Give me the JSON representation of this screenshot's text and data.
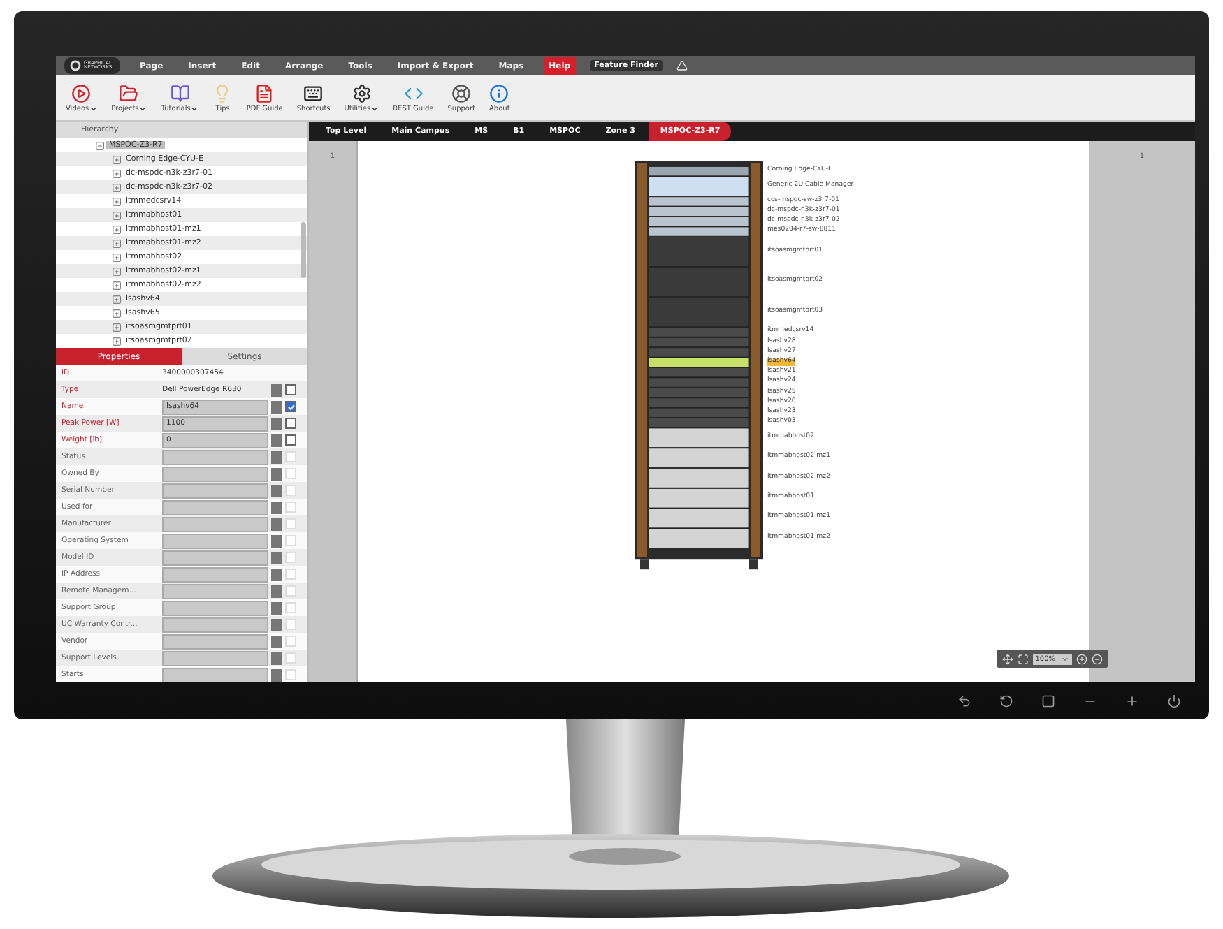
{
  "app": {
    "logo": "GRAPHICAL NETWORKS",
    "menu": [
      {
        "label": "Page",
        "selected": false
      },
      {
        "label": "Insert",
        "selected": false
      },
      {
        "label": "Edit",
        "selected": false
      },
      {
        "label": "Arrange",
        "selected": false
      },
      {
        "label": "Tools",
        "selected": false
      },
      {
        "label": "Import & Export",
        "selected": false
      },
      {
        "label": "Maps",
        "selected": false
      },
      {
        "label": "Help",
        "selected": true
      }
    ],
    "feature_finder": "Feature Finder",
    "toolbar": [
      {
        "kind": "video",
        "label": "Videos",
        "dropdown": true
      },
      {
        "kind": "projects",
        "label": "Projects",
        "dropdown": true
      },
      {
        "kind": "tutorials",
        "label": "Tutorials",
        "dropdown": true
      },
      {
        "kind": "tips",
        "label": "Tips",
        "dropdown": false
      },
      {
        "kind": "pdf",
        "label": "PDF Guide",
        "dropdown": false
      },
      {
        "kind": "shortcuts",
        "label": "Shortcuts",
        "dropdown": false
      },
      {
        "kind": "utilities",
        "label": "Utilities",
        "dropdown": true
      },
      {
        "kind": "rest",
        "label": "REST Guide",
        "dropdown": false
      },
      {
        "kind": "support",
        "label": "Support",
        "dropdown": false
      },
      {
        "kind": "about",
        "label": "About",
        "dropdown": false
      }
    ]
  },
  "hierarchy": {
    "title": "Hierarchy",
    "tree": [
      {
        "label": "MSPOC-Z3-R7",
        "expanded": true,
        "selected": true,
        "children": [
          {
            "label": "Corning Edge-CYU-E",
            "expanded": false,
            "selected": false
          },
          {
            "label": "dc-mspdc-n3k-z3r7-01",
            "expanded": false,
            "selected": false
          },
          {
            "label": "dc-mspdc-n3k-z3r7-02",
            "expanded": false,
            "selected": false
          },
          {
            "label": "itmmedcsrv14",
            "expanded": false,
            "selected": false
          },
          {
            "label": "itmmabhost01",
            "expanded": false,
            "selected": false
          },
          {
            "label": "itmmabhost01-mz1",
            "expanded": false,
            "selected": false
          },
          {
            "label": "itmmabhost01-mz2",
            "expanded": false,
            "selected": false
          },
          {
            "label": "itmmabhost02",
            "expanded": false,
            "selected": false
          },
          {
            "label": "itmmabhost02-mz1",
            "expanded": false,
            "selected": false
          },
          {
            "label": "itmmabhost02-mz2",
            "expanded": false,
            "selected": false
          },
          {
            "label": "lsashv64",
            "expanded": false,
            "selected": false
          },
          {
            "label": "lsashv65",
            "expanded": false,
            "selected": false
          },
          {
            "label": "itsoasmgmtprt01",
            "expanded": false,
            "selected": false
          },
          {
            "label": "itsoasmgmtprt02",
            "expanded": false,
            "selected": false
          }
        ]
      }
    ]
  },
  "panel_tabs": [
    {
      "label": "Properties",
      "selected": true
    },
    {
      "label": "Settings",
      "selected": false
    }
  ],
  "properties": [
    {
      "kind": "static",
      "label": "ID",
      "value": "3400000307454",
      "required": true
    },
    {
      "kind": "readonly",
      "label": "Type",
      "value": "Dell PowerEdge R630",
      "required": true,
      "checked": false
    },
    {
      "kind": "field",
      "label": "Name",
      "value": "lsashv64",
      "required": true,
      "checked": true
    },
    {
      "kind": "field",
      "label": "Peak Power [W]",
      "value": "1100",
      "required": true,
      "checked": false
    },
    {
      "kind": "field",
      "label": "Weight [lb]",
      "value": "0",
      "required": true,
      "checked": false
    },
    {
      "kind": "field",
      "label": "Status",
      "required": false,
      "checked": false
    },
    {
      "kind": "field",
      "label": "Owned By",
      "required": false,
      "checked": false
    },
    {
      "kind": "field",
      "label": "Serial Number",
      "required": false,
      "checked": false
    },
    {
      "kind": "field",
      "label": "Used for",
      "required": false,
      "checked": false
    },
    {
      "kind": "field",
      "label": "Manufacturer",
      "required": false,
      "checked": false
    },
    {
      "kind": "field",
      "label": "Operating System",
      "required": false,
      "checked": false
    },
    {
      "kind": "field",
      "label": "Model ID",
      "required": false,
      "checked": false
    },
    {
      "kind": "field",
      "label": "IP Address",
      "required": false,
      "checked": false
    },
    {
      "kind": "field",
      "label": "Remote Managem...",
      "required": false,
      "checked": false
    },
    {
      "kind": "field",
      "label": "Support Group",
      "required": false,
      "checked": false
    },
    {
      "kind": "field",
      "label": "UC Warranty Contr...",
      "required": false,
      "checked": false
    },
    {
      "kind": "field",
      "label": "Vendor",
      "required": false,
      "checked": false
    },
    {
      "kind": "field",
      "label": "Support Levels",
      "required": false,
      "checked": false
    },
    {
      "kind": "field",
      "label": "Starts",
      "required": false,
      "checked": false
    }
  ],
  "breadcrumb": [
    {
      "label": "Top Level",
      "selected": false
    },
    {
      "label": "Main Campus",
      "selected": false
    },
    {
      "label": "MS",
      "selected": false
    },
    {
      "label": "B1",
      "selected": false
    },
    {
      "label": "MSPOC",
      "selected": false
    },
    {
      "label": "Zone 3",
      "selected": false
    },
    {
      "label": "MSPOC-Z3-R7",
      "selected": true
    }
  ],
  "ruler_labels": [
    "1",
    "1"
  ],
  "rack": {
    "devices": [
      {
        "kind": "patch",
        "label": "Corning Edge-CYU-E",
        "selected": false
      },
      {
        "kind": "cable",
        "label": "Generic 2U Cable Manager",
        "selected": false
      },
      {
        "kind": "switch",
        "label": "ccs-mspdc-sw-z3r7-01",
        "selected": false
      },
      {
        "kind": "switch",
        "label": "dc-mspdc-n3k-z3r7-01",
        "selected": false
      },
      {
        "kind": "switch",
        "label": "dc-mspdc-n3k-z3r7-02",
        "selected": false
      },
      {
        "kind": "switch",
        "label": "mes0204-r7-sw-8811",
        "selected": false
      },
      {
        "kind": "server2",
        "label": "itsoasmgmtprt01",
        "selected": false
      },
      {
        "kind": "server2",
        "label": "itsoasmgmtprt02",
        "selected": false
      },
      {
        "kind": "server2",
        "label": "itsoasmgmtprt03",
        "selected": false
      },
      {
        "kind": "server1",
        "label": "itmmedcsrv14",
        "selected": false
      },
      {
        "kind": "server1",
        "label": "lsashv28",
        "selected": false
      },
      {
        "kind": "server1",
        "label": "lsashv27",
        "selected": false
      },
      {
        "kind": "server1",
        "label": "lsashv64",
        "selected": true
      },
      {
        "kind": "server1",
        "label": "lsashv21",
        "selected": false
      },
      {
        "kind": "server1",
        "label": "lsashv24",
        "selected": false
      },
      {
        "kind": "server1",
        "label": "lsashv25",
        "selected": false
      },
      {
        "kind": "server1",
        "label": "lsashv20",
        "selected": false
      },
      {
        "kind": "server1",
        "label": "lsashv23",
        "selected": false
      },
      {
        "kind": "server1",
        "label": "lsashv03",
        "selected": false
      },
      {
        "kind": "chassis",
        "label": "itmmabhost02",
        "selected": false
      },
      {
        "kind": "chassis",
        "label": "itmmabhost02-mz1",
        "selected": false
      },
      {
        "kind": "chassis",
        "label": "itmmabhost02-mz2",
        "selected": false
      },
      {
        "kind": "chassis",
        "label": "itmmabhost01",
        "selected": false
      },
      {
        "kind": "chassis",
        "label": "itmmabhost01-mz1",
        "selected": false
      },
      {
        "kind": "chassis",
        "label": "itmmabhost01-mz2",
        "selected": false
      }
    ]
  },
  "zoom": {
    "value": "100%"
  }
}
